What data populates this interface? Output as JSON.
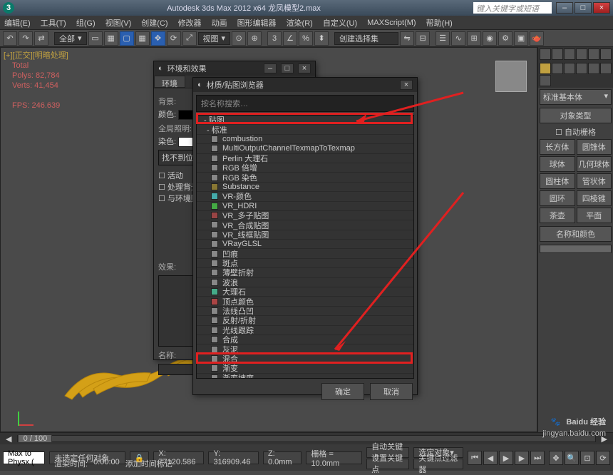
{
  "title": "Autodesk 3ds Max 2012 x64     龙凤模型2.max",
  "search_placeholder": "键入关键字或短语",
  "menu": [
    "编辑(E)",
    "工具(T)",
    "组(G)",
    "视图(V)",
    "创建(C)",
    "修改器",
    "动画",
    "图形编辑器",
    "渲染(R)",
    "自定义(U)",
    "MAXScript(M)",
    "帮助(H)"
  ],
  "toolbar_combo": "全部",
  "toolbar_combo2": "创建选择集",
  "viewport": {
    "label": "[+][正交][明暗处理]",
    "stats": "Total\nPolys: 82,784\nVerts: 41,454\n\nFPS: 246.639"
  },
  "right": {
    "combo": "标准基本体",
    "section1": "对象类型",
    "autogrid": "自动栅格",
    "grid": [
      [
        "长方体",
        "圆锥体"
      ],
      [
        "球体",
        "几何球体"
      ],
      [
        "圆柱体",
        "管状体"
      ],
      [
        "圆环",
        "四棱锥"
      ],
      [
        "茶壶",
        "平面"
      ]
    ],
    "section2": "名称和颜色"
  },
  "env": {
    "title": "环境和效果",
    "tab1": "环境",
    "bg": "背景:",
    "color": "颜色:",
    "global": "全局照明:",
    "tint": "染色:",
    "notfound": "找不到位图",
    "chk1": "活动",
    "chk2": "处理背景",
    "chk3": "与环境贴图",
    "effect": "效果:",
    "name": "名称:"
  },
  "browser": {
    "title": "材质/贴图浏览器",
    "search": "按名称搜索…",
    "cat": "- 贴图",
    "sel": "- 标准",
    "items": [
      "combustion",
      "MultiOutputChannelTexmapToTexmap",
      "Perlin 大理石",
      "RGB 倍增",
      "RGB 染色",
      "Substance",
      "VR-颜色",
      "VR_HDRI",
      "VR_多子贴图",
      "VR_合成贴图",
      "VR_线框贴图",
      "VRayGLSL",
      "凹痕",
      "斑点",
      "薄壁折射",
      "波浪",
      "大理石",
      "顶点颜色",
      "法线凸凹",
      "反射/折射",
      "光线跟踪",
      "合成",
      "灰泥",
      "混合",
      "渐变",
      "渐变坡度"
    ],
    "ok": "确定",
    "cancel": "取消"
  },
  "timeline": {
    "pos": "0 / 100"
  },
  "status": {
    "script_label": "Max to Physx (",
    "sel": "未选定任何对象",
    "x": "X: 77120.586",
    "y": "Y: 316909.46",
    "z": "Z: 0.0mm",
    "grid": "栅格 = 10.0mm",
    "auto_key": "自动关键点",
    "sel_obj": "选定对象",
    "set_key": "设置关键点",
    "key_filter": "关键点过滤器",
    "render": "渲染时间:",
    "time": "0:00:00",
    "add": "添加时间标记"
  },
  "watermark": {
    "logo": "Baidu 经验",
    "url": "jingyan.baidu.com"
  },
  "swatch_colors": [
    "#888",
    "#888",
    "#888",
    "#888",
    "#888",
    "#887733",
    "#4aa",
    "#4a4",
    "#944",
    "#888",
    "#888",
    "#888",
    "#888",
    "#888",
    "#888",
    "#888",
    "#4a8",
    "#a44",
    "#888",
    "#888",
    "#888",
    "#888",
    "#888",
    "#888",
    "#888",
    "#888"
  ]
}
